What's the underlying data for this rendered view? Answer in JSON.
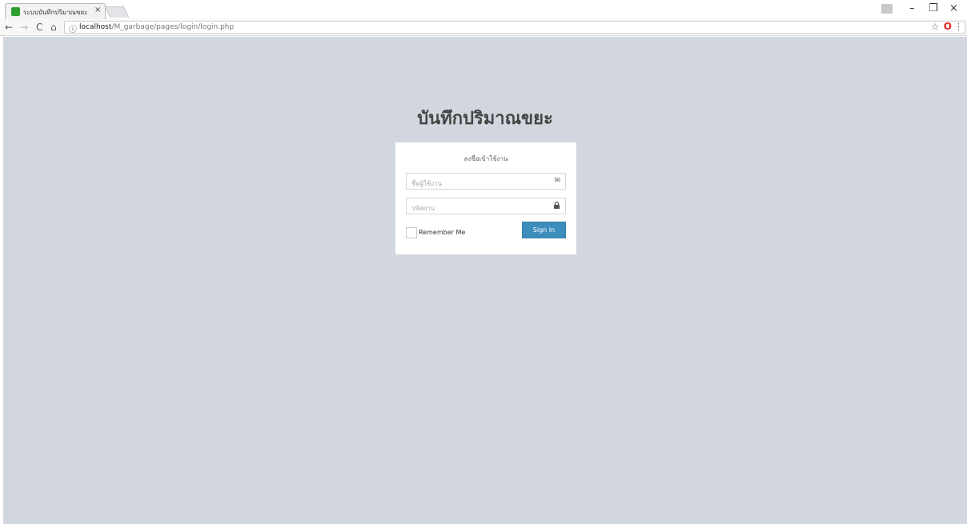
{
  "browser": {
    "tab_title": "ระบบบันทึกปริมาณขยะ",
    "tab_close": "×",
    "url_host": "localhost",
    "url_path": "/M_garbage/pages/login/login.php",
    "nav": {
      "back": "←",
      "forward": "→",
      "reload": "C",
      "home": "⌂"
    },
    "icons": {
      "info": "ⓘ",
      "star": "☆",
      "opera": "O",
      "menu": "⋮"
    },
    "window": {
      "minimize": "–",
      "maximize": "❐",
      "close": "×"
    }
  },
  "page": {
    "background": "#d2d6de",
    "logo": "บันทึกปริมาณขยะ",
    "login_box_msg": "ลงชื่อเข้าใช้งาน",
    "username_placeholder": "ชื่อผู้ใช้งาน",
    "password_placeholder": "รหัสผ่าน",
    "username_icon": "envelope-icon",
    "password_icon": "lock-icon",
    "remember_label": "Remember Me",
    "signin_label": "Sign In",
    "accent_color": "#3c8dbc"
  }
}
